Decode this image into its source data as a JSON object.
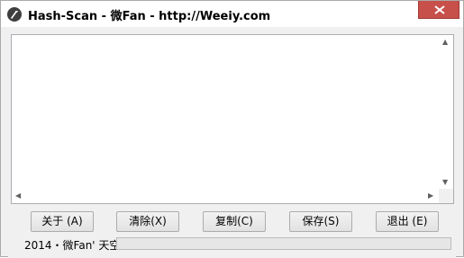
{
  "window": {
    "title": "Hash-Scan - 微Fan - http://Weeiy.com"
  },
  "output": {
    "text": ""
  },
  "buttons": {
    "about": "关于 (A)",
    "clear": "清除(X)",
    "copy": "复制(C)",
    "save": "保存(S)",
    "exit": "退出 (E)"
  },
  "status": {
    "credit": "2014・微Fan' 天空",
    "progress": 0
  },
  "colors": {
    "close_button": "#c7504a",
    "progress_fill": "#06b025"
  }
}
